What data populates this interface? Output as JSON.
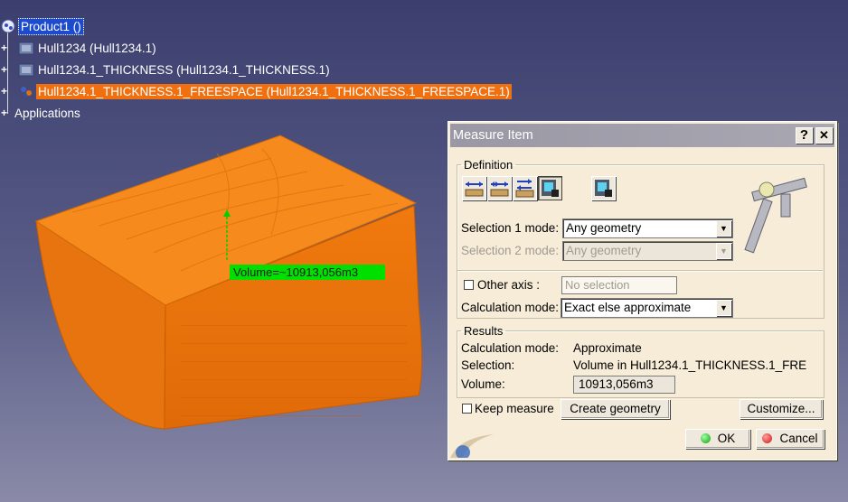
{
  "tree": {
    "root": "Product1 ()",
    "items": [
      "Hull1234 (Hull1234.1)",
      "Hull1234.1_THICKNESS (Hull1234.1_THICKNESS.1)",
      "Hull1234.1_THICKNESS.1_FREESPACE (Hull1234.1_THICKNESS.1_FREESPACE.1)",
      "Applications"
    ]
  },
  "viewport": {
    "measure_label": "Volume=~10913,056m3",
    "part_color": "#f07c10"
  },
  "dialog": {
    "title": "Measure Item",
    "help_btn": "?",
    "close_btn": "✕",
    "definition": {
      "legend": "Definition",
      "tool_icons": [
        "measure-between-icon",
        "measure-item-chain-icon",
        "measure-fan-icon",
        "measure-item-icon",
        "measure-thickness-icon"
      ],
      "selection1_label": "Selection 1 mode:",
      "selection1_value": "Any geometry",
      "selection2_label": "Selection 2 mode:",
      "selection2_value": "Any geometry",
      "other_axis_label": "Other axis :",
      "other_axis_value": "No selection",
      "calc_mode_label": "Calculation mode:",
      "calc_mode_value": "Exact else approximate"
    },
    "results": {
      "legend": "Results",
      "rows": [
        {
          "label": "Calculation mode:",
          "value": "Approximate"
        },
        {
          "label": "Selection:",
          "value": "Volume in Hull1234.1_THICKNESS.1_FRE"
        }
      ],
      "volume_label": "Volume:",
      "volume_value": "10913,056m3"
    },
    "keep_measure_label": "Keep measure",
    "create_geometry_label": "Create geometry",
    "customize_label": "Customize...",
    "ok_label": "OK",
    "cancel_label": "Cancel"
  },
  "colors": {
    "selection_orange": "#f07010",
    "selection_blue": "#1c4bd0",
    "label_green": "#00e000"
  }
}
